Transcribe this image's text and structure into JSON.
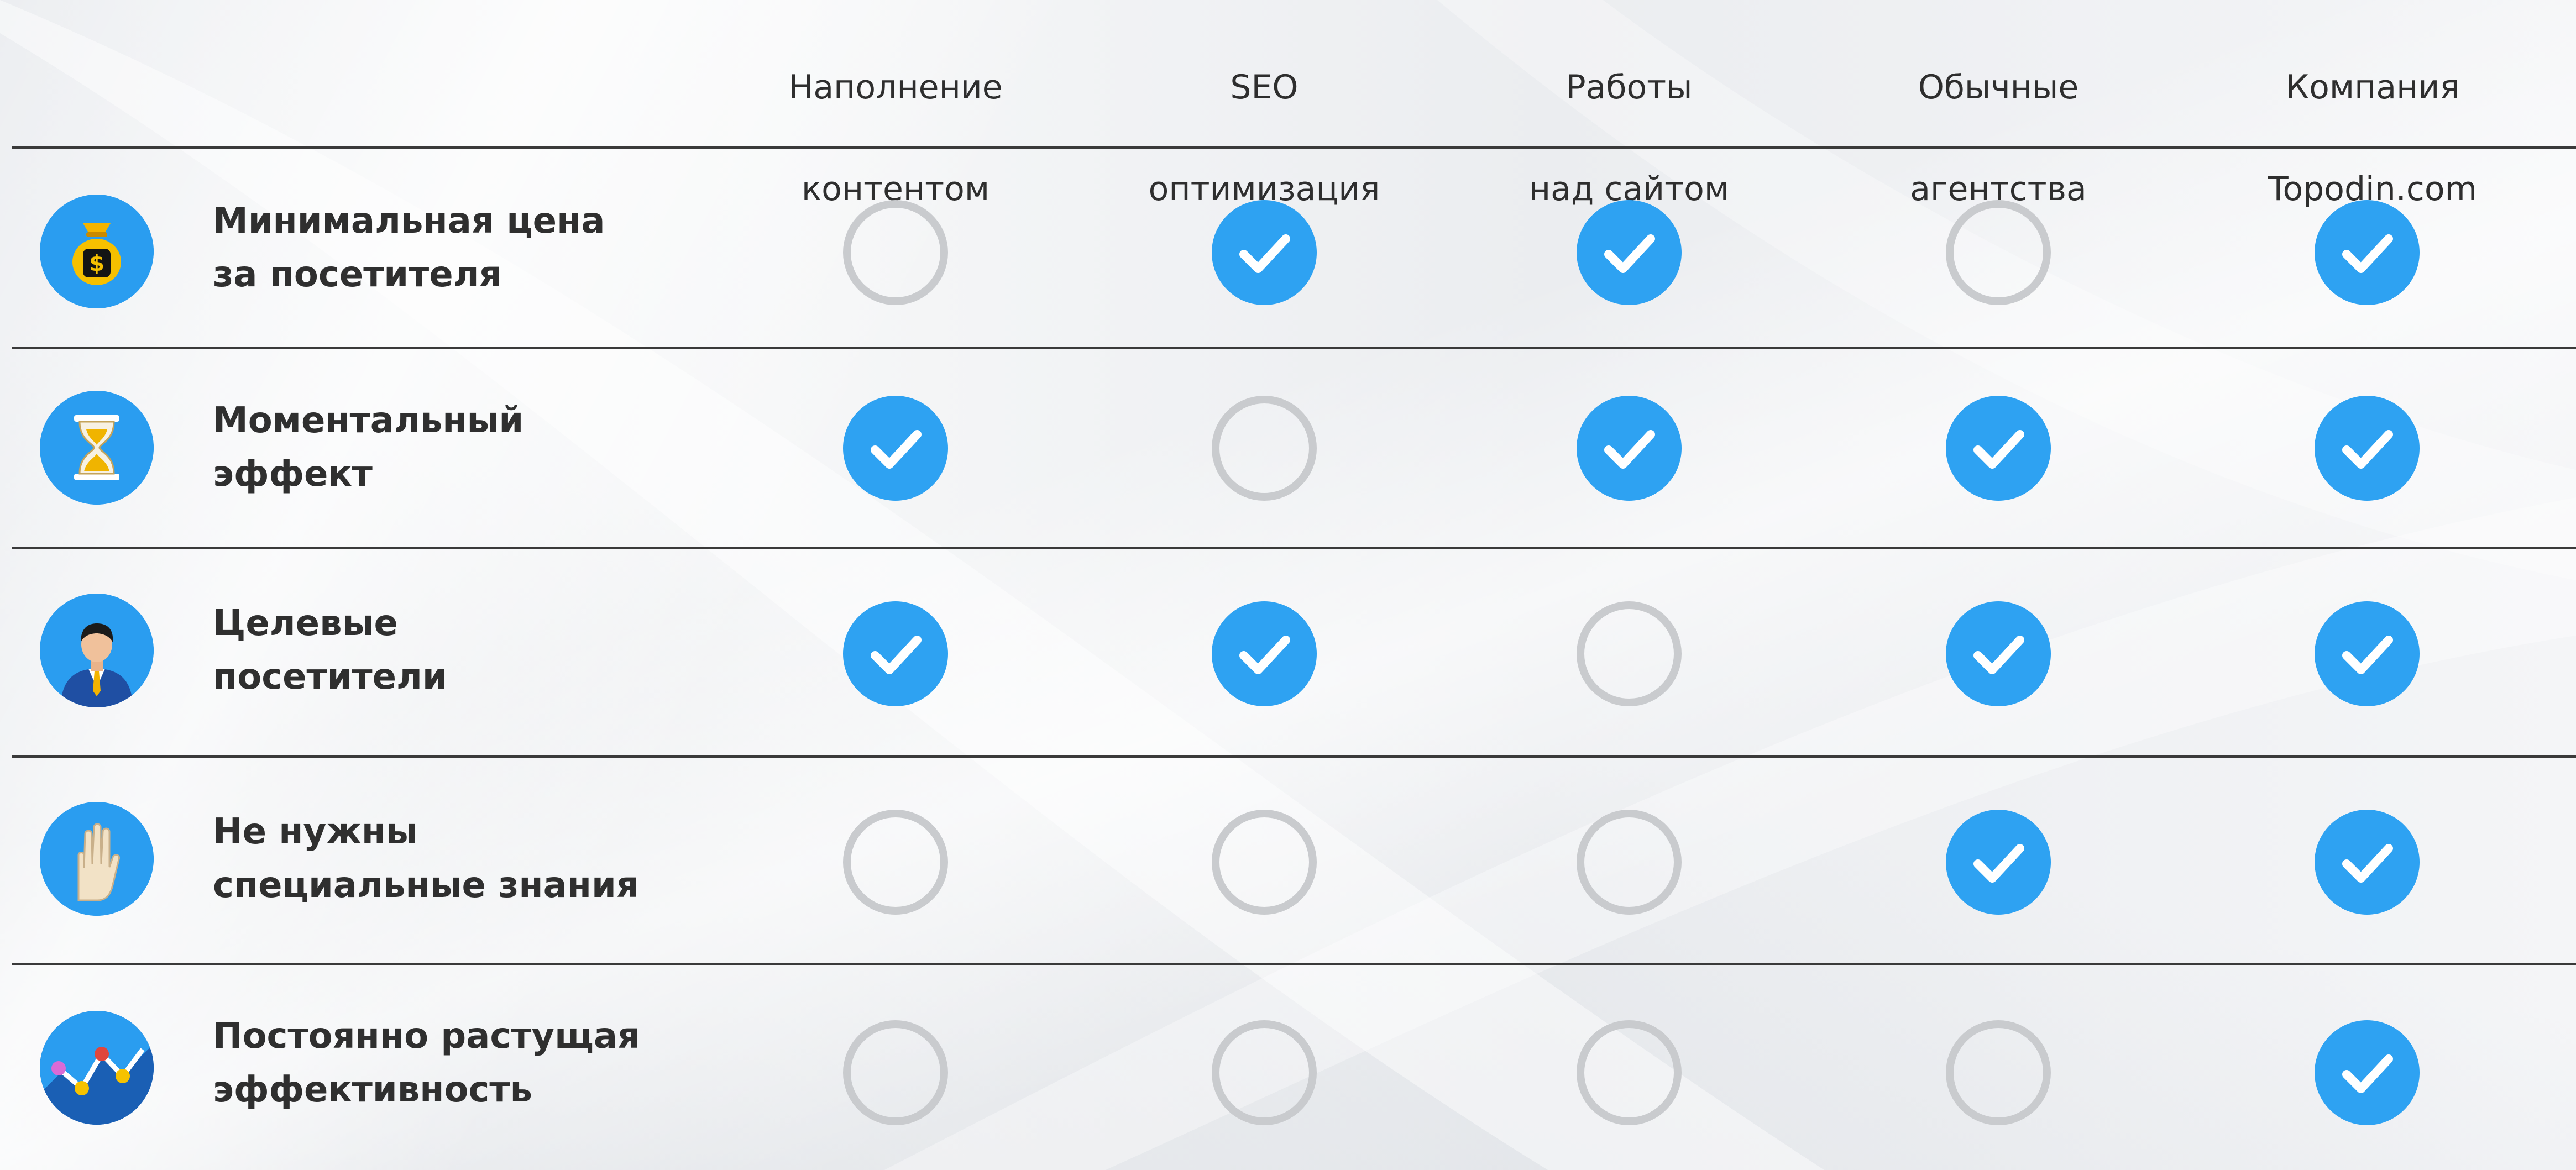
{
  "columns": [
    {
      "line1": "Наполнение",
      "line2": "контентом"
    },
    {
      "line1": "SEO",
      "line2": "оптимизация"
    },
    {
      "line1": "Работы",
      "line2": "над сайтом"
    },
    {
      "line1": "Обычные",
      "line2": "агентства"
    },
    {
      "line1": "Компания",
      "line2": "Topodin.com"
    }
  ],
  "rows": [
    {
      "icon": "money-bag-icon",
      "line1": "Минимальная цена",
      "line2": "за посетителя",
      "checks": [
        false,
        true,
        true,
        false,
        true
      ]
    },
    {
      "icon": "hourglass-icon",
      "line1": "Моментальный",
      "line2": "эффект",
      "checks": [
        true,
        false,
        true,
        true,
        true
      ]
    },
    {
      "icon": "businessman-icon",
      "line1": "Целевые",
      "line2": "посетители",
      "checks": [
        true,
        true,
        false,
        true,
        true
      ]
    },
    {
      "icon": "hand-icon",
      "line1": "Не нужны",
      "line2": "специальные знания",
      "checks": [
        false,
        false,
        false,
        true,
        true
      ]
    },
    {
      "icon": "growth-chart-icon",
      "line1": "Постоянно растущая",
      "line2": "эффективность",
      "checks": [
        false,
        false,
        false,
        false,
        true
      ]
    }
  ],
  "colors": {
    "check": "#2ea2f2",
    "empty": "#c9cbce",
    "icon_bg": "#2a9df0"
  }
}
